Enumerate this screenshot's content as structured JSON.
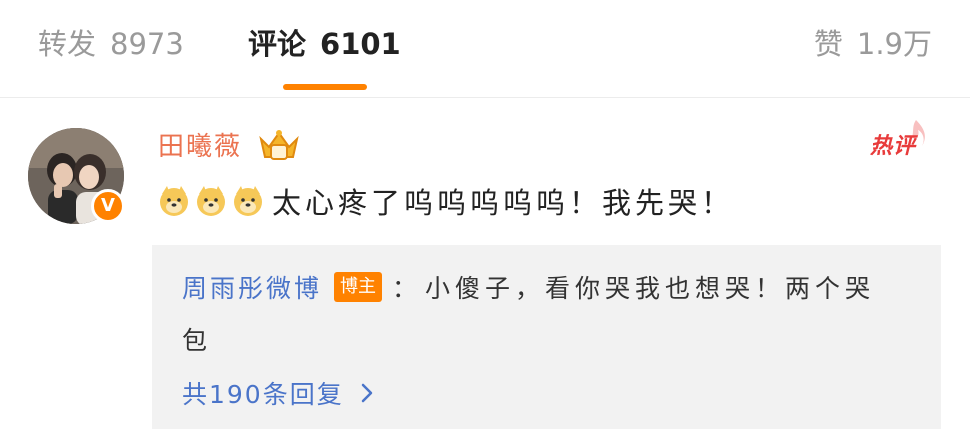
{
  "tabs": {
    "repost": {
      "label": "转发",
      "count": "8973"
    },
    "comment": {
      "label": "评论",
      "count": "6101"
    },
    "like": {
      "label": "赞",
      "count": "1.9万"
    }
  },
  "colors": {
    "accent": "#ff8200",
    "username": "#eb7350",
    "link": "#4a74c9",
    "hot": "#e83b3b",
    "reply_bg": "#f2f2f2"
  },
  "comment": {
    "username": "田曦薇",
    "hot_label": "热评",
    "verify_icon": "v-verified-icon",
    "member_icon": "vip-crown-icon",
    "emojis": [
      "doge-icon",
      "doge-icon",
      "doge-icon"
    ],
    "text": "太心疼了呜呜呜呜呜！我先哭！"
  },
  "reply": {
    "author": "周雨彤微博",
    "author_tag": "博主",
    "colon": "：",
    "text_line1": "小傻子，看你哭我也想哭！两个哭",
    "text_line2": "包",
    "more_label": "共190条回复"
  }
}
